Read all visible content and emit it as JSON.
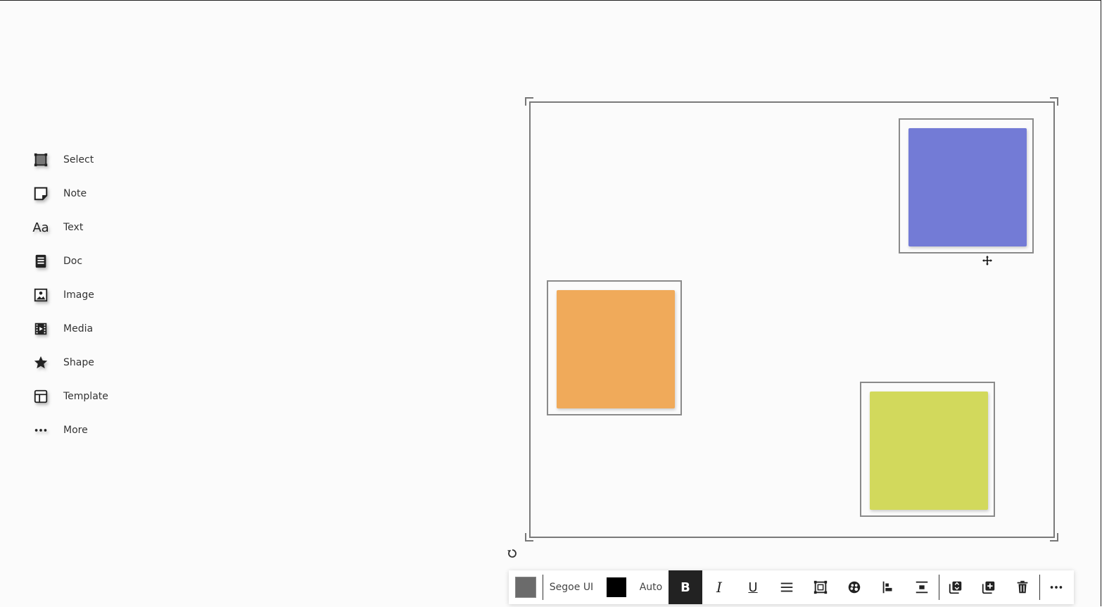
{
  "sidebar": {
    "items": [
      {
        "label": "Select",
        "icon": "select-icon"
      },
      {
        "label": "Note",
        "icon": "note-icon"
      },
      {
        "label": "Text",
        "icon": "text-icon",
        "glyph": "Aa"
      },
      {
        "label": "Doc",
        "icon": "doc-icon"
      },
      {
        "label": "Image",
        "icon": "image-icon"
      },
      {
        "label": "Media",
        "icon": "media-icon"
      },
      {
        "label": "Shape",
        "icon": "star-icon"
      },
      {
        "label": "Template",
        "icon": "template-icon"
      },
      {
        "label": "More",
        "icon": "more-icon"
      }
    ]
  },
  "canvas": {
    "notes": [
      {
        "name": "note-blue",
        "color": "#737bd6"
      },
      {
        "name": "note-orange",
        "color": "#f0aa5a"
      },
      {
        "name": "note-green",
        "color": "#d2d95c"
      }
    ]
  },
  "toolbar": {
    "fill_color": "#6b6b6b",
    "font_family": "Segoe UI",
    "text_color": "#000000",
    "font_size": "Auto",
    "bold_glyph": "B",
    "italic_glyph": "I",
    "underline_glyph": "U",
    "bold_active": true
  }
}
